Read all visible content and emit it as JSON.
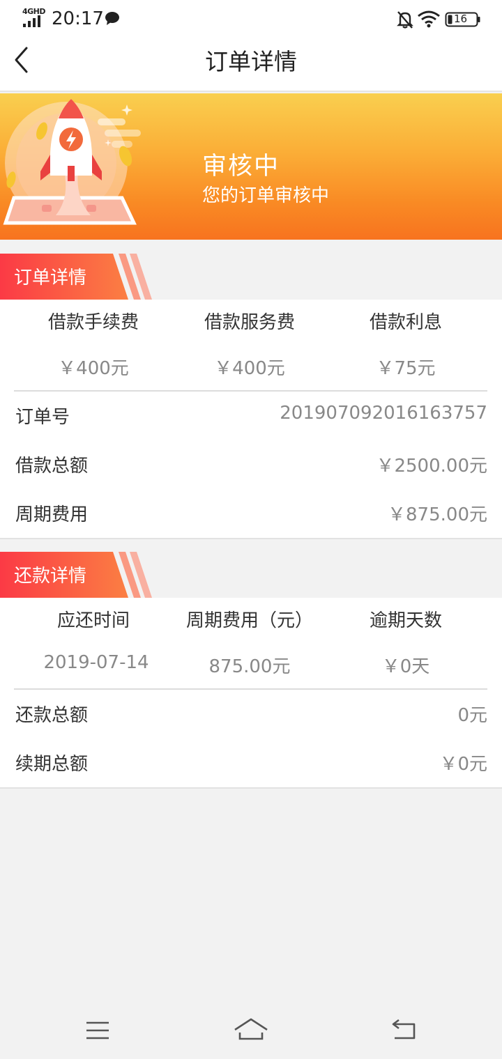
{
  "status_bar": {
    "network": "4GHD",
    "time": "20:17",
    "battery": "16"
  },
  "nav": {
    "title": "订单详情"
  },
  "banner": {
    "status": "审核中",
    "subtitle": "您的订单审核中"
  },
  "order_section": {
    "tag": "订单详情",
    "fees": [
      {
        "label": "借款手续费",
        "value": "￥400元"
      },
      {
        "label": "借款服务费",
        "value": "￥400元"
      },
      {
        "label": "借款利息",
        "value": "￥75元"
      }
    ],
    "rows": [
      {
        "label": "订单号",
        "value": "20190709201616​3757"
      },
      {
        "label": "借款总额",
        "value": "￥2500.00元"
      },
      {
        "label": "周期费用",
        "value": "￥875.00元"
      }
    ]
  },
  "repay_section": {
    "tag": "还款详情",
    "cols": [
      {
        "label": "应还时间",
        "value": "2019-07-14"
      },
      {
        "label": "周期费用（元）",
        "value": "875.00元"
      },
      {
        "label": "逾期天数",
        "value": "￥0天"
      }
    ],
    "rows": [
      {
        "label": "还款总额",
        "value": "0元"
      },
      {
        "label": "续期总额",
        "value": "￥0元"
      }
    ]
  },
  "colors": {
    "accent_start": "#fb3a45",
    "accent_end": "#fb7f43",
    "banner_top": "#f9cf4f",
    "banner_bottom": "#f8731f"
  }
}
